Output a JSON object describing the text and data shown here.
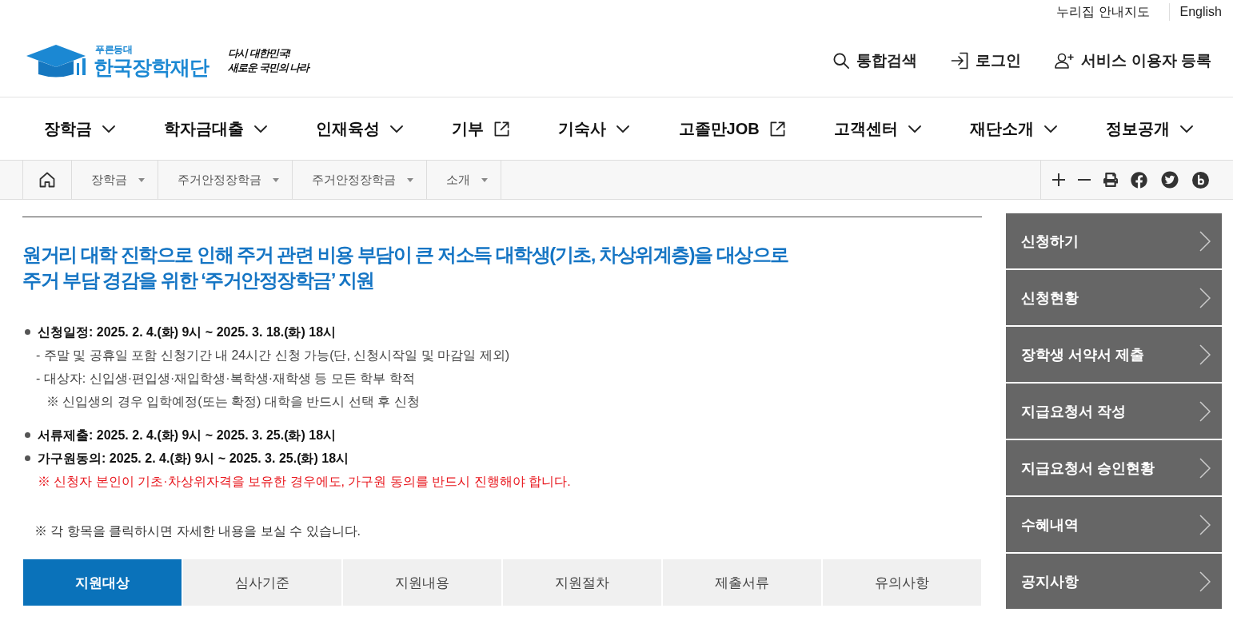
{
  "top_links": [
    {
      "label": "누리집 안내지도"
    },
    {
      "label": "English"
    }
  ],
  "logo": {
    "tagline": "푸른등대",
    "name": "한국장학재단",
    "slogan": [
      "다시 대한민국!",
      "새로운 국민의 나라"
    ]
  },
  "utility_links": [
    {
      "kind": "search",
      "label": "통합검색"
    },
    {
      "kind": "login",
      "label": "로그인"
    },
    {
      "kind": "register",
      "label": "서비스 이용자 등록"
    }
  ],
  "main_nav": [
    {
      "label": "장학금",
      "kind": "dropdown"
    },
    {
      "label": "학자금대출",
      "kind": "dropdown"
    },
    {
      "label": "인재육성",
      "kind": "dropdown"
    },
    {
      "label": "기부",
      "kind": "external"
    },
    {
      "label": "기숙사",
      "kind": "dropdown"
    },
    {
      "label": "고졸만JOB",
      "kind": "external"
    },
    {
      "label": "고객센터",
      "kind": "dropdown"
    },
    {
      "label": "재단소개",
      "kind": "dropdown"
    },
    {
      "label": "정보공개",
      "kind": "dropdown"
    }
  ],
  "breadcrumb": [
    "장학금",
    "주거안정장학금",
    "주거안정장학금",
    "소개"
  ],
  "intro": {
    "heading": [
      "원거리 대학 진학으로 인해 주거 관련 비용 부담이 큰 저소득 대학생(기초, 차상위계층)을 대상으로",
      "주거 부담 경감을 위한 ‘주거안정장학금’ 지원"
    ],
    "groups": [
      {
        "items": [
          {
            "kind": "bullet",
            "text": "신청일정: 2025. 2. 4.(화) 9시 ~ 2025. 3. 18.(화) 18시"
          },
          {
            "kind": "dash",
            "text": "- 주말 및 공휴일 포함 신청기간 내 24시간 신청 가능(단, 신청시작일 및 마감일 제외)"
          },
          {
            "kind": "dash",
            "text": "- 대상자: 신입생·편입생·재입학생·복학생·재학생 등 모든 학부 학적"
          },
          {
            "kind": "note",
            "text": "※ 신입생의 경우 입학예정(또는 확정) 대학을 반드시 선택 후 신청"
          }
        ]
      },
      {
        "items": [
          {
            "kind": "bullet",
            "text": "서류제출: 2025. 2. 4.(화) 9시 ~ 2025. 3. 25.(화) 18시"
          },
          {
            "kind": "bullet",
            "text": "가구원동의: 2025. 2. 4.(화) 9시 ~ 2025. 3. 25.(화) 18시"
          },
          {
            "kind": "warning",
            "text": "※ 신청자 본인이 기초·차상위자격을 보유한 경우에도, 가구원 동의를 반드시 진행해야 합니다."
          }
        ]
      }
    ],
    "notice": "※ 각 항목을 클릭하시면 자세한 내용을 보실 수 있습니다."
  },
  "tabs": [
    {
      "label": "지원대상",
      "selected": true
    },
    {
      "label": "심사기준",
      "selected": false
    },
    {
      "label": "지원내용",
      "selected": false
    },
    {
      "label": "지원절차",
      "selected": false
    },
    {
      "label": "제출서류",
      "selected": false
    },
    {
      "label": "유의사항",
      "selected": false
    }
  ],
  "side_menu": [
    {
      "label": "신청하기"
    },
    {
      "label": "신청현황"
    },
    {
      "label": "장학생 서약서 제출"
    },
    {
      "label": "지급요청서 작성"
    },
    {
      "label": "지급요청서 승인현황"
    },
    {
      "label": "수혜내역"
    },
    {
      "label": "공지사항"
    }
  ]
}
